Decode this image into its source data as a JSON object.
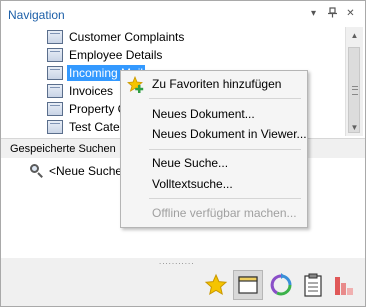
{
  "header": {
    "title": "Navigation",
    "pin_glyph": "▾",
    "dock_glyph": "⊥",
    "close_glyph": "✕"
  },
  "tree": {
    "items": [
      {
        "label": "Customer Complaints",
        "selected": false
      },
      {
        "label": "Employee Details",
        "selected": false
      },
      {
        "label": "Incoming Mail",
        "selected": true
      },
      {
        "label": "Invoices",
        "selected": false
      },
      {
        "label": "Property C",
        "selected": false
      },
      {
        "label": "Test Categ",
        "selected": false
      }
    ]
  },
  "scrollbar": {
    "up_glyph": "▲",
    "down_glyph": "▼"
  },
  "saved_searches": {
    "title": "Gespeicherte Suchen",
    "items": [
      {
        "label": "<Neue Suche>"
      }
    ]
  },
  "splitter": {
    "dots": "..........."
  },
  "context_menu": {
    "items": [
      {
        "label": "Zu Favoriten hinzufügen",
        "icon": "add-favorite-icon",
        "disabled": false
      },
      {
        "label": "Neues Dokument...",
        "disabled": false
      },
      {
        "label": "Neues Dokument in Viewer...",
        "disabled": false
      },
      {
        "label": "Neue Suche...",
        "disabled": false
      },
      {
        "label": "Volltextsuche...",
        "disabled": false
      },
      {
        "label": "Offline verfügbar machen...",
        "disabled": true
      }
    ]
  },
  "toolbar": {
    "buttons": [
      {
        "icon": "favorites-star-icon",
        "active": false
      },
      {
        "icon": "folder-window-icon",
        "active": true
      },
      {
        "icon": "refresh-cycle-icon",
        "active": false
      },
      {
        "icon": "clipboard-icon",
        "active": false
      },
      {
        "icon": "bar-chart-icon",
        "active": false
      }
    ]
  },
  "colors": {
    "accent": "#1c5fa8",
    "selection": "#3399ff",
    "star": "#f5c400"
  }
}
